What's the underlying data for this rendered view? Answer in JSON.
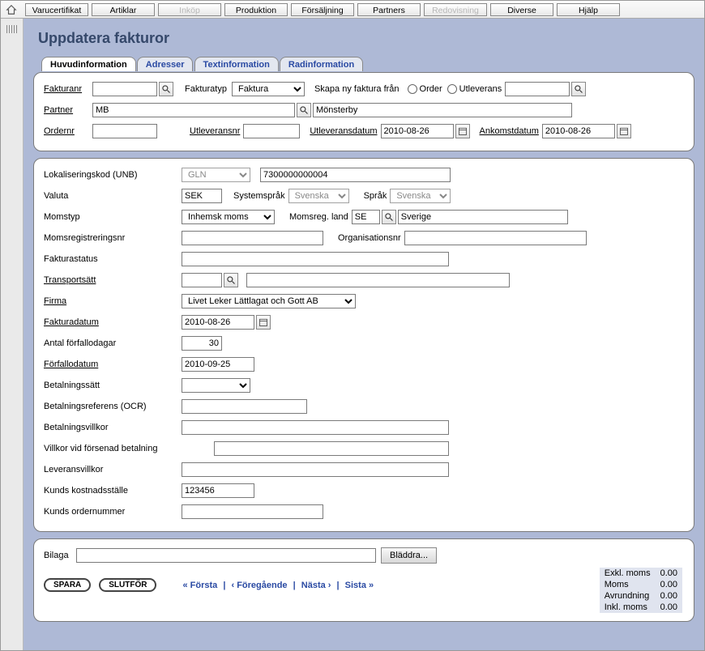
{
  "topmenu": {
    "items": [
      {
        "label": "Varucertifikat",
        "disabled": false
      },
      {
        "label": "Artiklar",
        "disabled": false
      },
      {
        "label": "Inköp",
        "disabled": true
      },
      {
        "label": "Produktion",
        "disabled": false
      },
      {
        "label": "Försäljning",
        "disabled": false
      },
      {
        "label": "Partners",
        "disabled": false
      },
      {
        "label": "Redovisning",
        "disabled": true
      },
      {
        "label": "Diverse",
        "disabled": false
      },
      {
        "label": "Hjälp",
        "disabled": false
      }
    ]
  },
  "page_title": "Uppdatera fakturor",
  "tabs": [
    {
      "label": "Huvudinformation",
      "selected": true
    },
    {
      "label": "Adresser",
      "selected": false
    },
    {
      "label": "Textinformation",
      "selected": false
    },
    {
      "label": "Radinformation",
      "selected": false
    }
  ],
  "header": {
    "fakturanr_label": "Fakturanr",
    "fakturanr": "",
    "fakturatyp_label": "Fakturatyp",
    "fakturatyp": "Faktura",
    "skapa_label": "Skapa ny faktura från",
    "order_label": "Order",
    "utleverans_label": "Utleverans",
    "utleverans_ref": "",
    "partner_label": "Partner",
    "partner_code": "MB",
    "partner_name": "Mönsterby",
    "ordernr_label": "Ordernr",
    "ordernr": "",
    "utleveransnr_label": "Utleveransnr",
    "utleveransnr": "",
    "utleveransdatum_label": "Utleveransdatum",
    "utleveransdatum": "2010-08-26",
    "ankomstdatum_label": "Ankomstdatum",
    "ankomstdatum": "2010-08-26"
  },
  "body": {
    "lokaliseringskod_label": "Lokaliseringskod (UNB)",
    "lokaliseringskod_type": "GLN",
    "lokaliseringskod_value": "7300000000004",
    "valuta_label": "Valuta",
    "valuta": "SEK",
    "systemsprak_label": "Systemspråk",
    "systemsprak": "Svenska",
    "sprak_label": "Språk",
    "sprak": "Svenska",
    "momstyp_label": "Momstyp",
    "momstyp": "Inhemsk moms",
    "momsreg_land_label": "Momsreg. land",
    "momsreg_land_code": "SE",
    "momsreg_land_name": "Sverige",
    "momsregnr_label": "Momsregistreringsnr",
    "momsregnr": "",
    "orgnr_label": "Organisationsnr",
    "orgnr": "",
    "fakturastatus_label": "Fakturastatus",
    "fakturastatus": "",
    "transportsatt_label": "Transportsätt",
    "transportsatt_code": "",
    "transportsatt_name": "",
    "firma_label": "Firma",
    "firma": "Livet Leker Lättlagat och Gott AB",
    "fakturadatum_label": "Fakturadatum",
    "fakturadatum": "2010-08-26",
    "antal_forfallodagar_label": "Antal förfallodagar",
    "antal_forfallodagar": "30",
    "forfallodatum_label": "Förfallodatum",
    "forfallodatum": "2010-09-25",
    "betalningssatt_label": "Betalningssätt",
    "betalningssatt": "",
    "betalningsreferens_label": "Betalningsreferens (OCR)",
    "betalningsreferens": "",
    "betalningsvillkor_label": "Betalningsvillkor",
    "betalningsvillkor": "",
    "villkor_forsenad_label": "Villkor vid försenad betalning",
    "villkor_forsenad": "",
    "leveransvillkor_label": "Leveransvillkor",
    "leveransvillkor": "",
    "kostnadsstalle_label": "Kunds kostnadsställe",
    "kostnadsstalle": "123456",
    "kunds_ordernr_label": "Kunds ordernummer",
    "kunds_ordernr": ""
  },
  "attachment": {
    "bilaga_label": "Bilaga",
    "bilaga_value": "",
    "browse_label": "Bläddra..."
  },
  "actions": {
    "spara": "SPARA",
    "slutfor": "SLUTFÖR"
  },
  "paginator": {
    "first": "« Första",
    "prev": "‹ Föregående",
    "next": "Nästa ›",
    "last": "Sista »",
    "sep": "|"
  },
  "totals": {
    "rows": [
      {
        "label": "Exkl. moms",
        "value": "0.00"
      },
      {
        "label": "Moms",
        "value": "0.00"
      },
      {
        "label": "Avrundning",
        "value": "0.00"
      },
      {
        "label": "Inkl. moms",
        "value": "0.00"
      }
    ]
  }
}
